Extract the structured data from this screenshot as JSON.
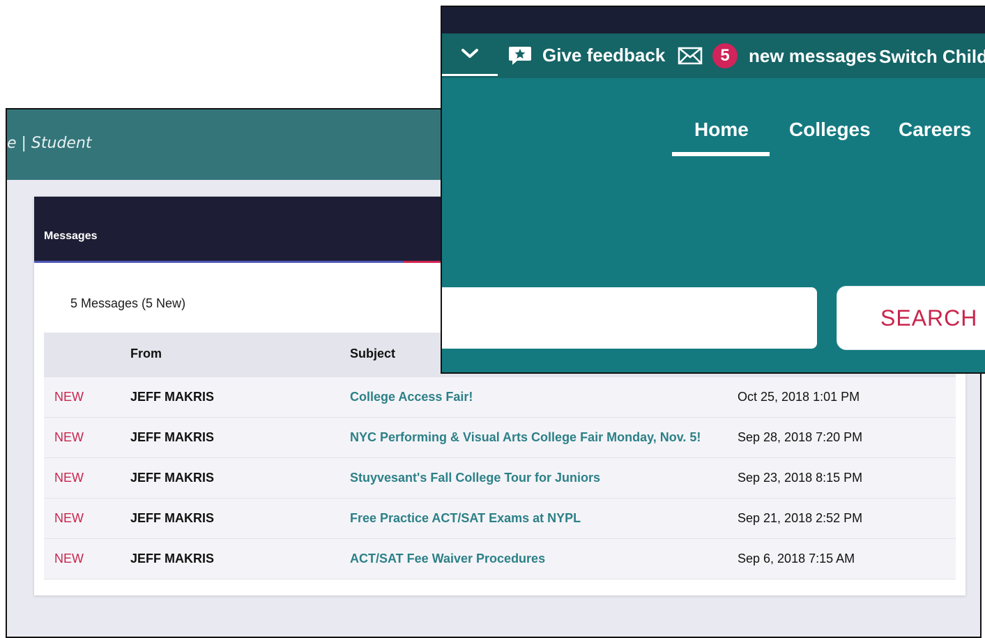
{
  "back_window": {
    "header_title": "e | Student",
    "messages_card": {
      "title": "Messages",
      "count_text": "5 Messages (5 New)",
      "columns": {
        "from": "From",
        "subject": "Subject"
      },
      "rows": [
        {
          "status": "NEW",
          "from": "JEFF MAKRIS",
          "subject": "College Access Fair!",
          "date": "Oct 25, 2018 1:01 PM"
        },
        {
          "status": "NEW",
          "from": "JEFF MAKRIS",
          "subject": "NYC Performing & Visual Arts College Fair Monday, Nov. 5!",
          "date": "Sep 28, 2018 7:20 PM"
        },
        {
          "status": "NEW",
          "from": "JEFF MAKRIS",
          "subject": "Stuyvesant's Fall College Tour for Juniors",
          "date": "Sep 23, 2018 8:15 PM"
        },
        {
          "status": "NEW",
          "from": "JEFF MAKRIS",
          "subject": "Free Practice ACT/SAT Exams at NYPL",
          "date": "Sep 21, 2018 2:52 PM"
        },
        {
          "status": "NEW",
          "from": "JEFF MAKRIS",
          "subject": "ACT/SAT Fee Waiver Procedures",
          "date": "Sep 6, 2018 7:15 AM"
        }
      ]
    }
  },
  "front_window": {
    "utility_bar": {
      "feedback_label": "Give feedback",
      "message_count": "5",
      "messages_label": "new messages",
      "switch_child_label": "Switch Child:"
    },
    "nav": {
      "home": "Home",
      "colleges": "Colleges",
      "careers": "Careers"
    },
    "search": {
      "placeholder": "",
      "button_label": "SEARCH"
    }
  },
  "colors": {
    "teal_header": "#147a80",
    "dark_navy": "#1d1e35",
    "accent_pink": "#c8254c",
    "subject_link": "#2d8087"
  },
  "icons": [
    "chevron-down-icon",
    "feedback-star-icon",
    "envelope-icon"
  ]
}
